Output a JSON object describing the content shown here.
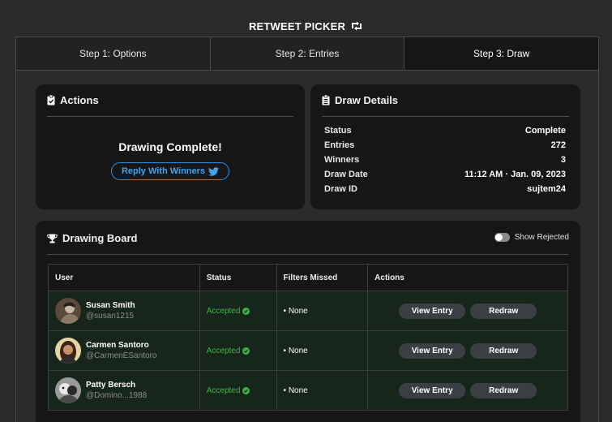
{
  "app": {
    "title": "RETWEET PICKER",
    "title_icon": "retweet-icon"
  },
  "tabs": [
    {
      "label": "Step 1: Options",
      "active": false
    },
    {
      "label": "Step 2: Entries",
      "active": false
    },
    {
      "label": "Step 3: Draw",
      "active": true
    }
  ],
  "actions_card": {
    "title": "Actions",
    "icon": "clipboard-check-icon",
    "status_message": "Drawing Complete!",
    "reply_button": "Reply With Winners",
    "reply_icon": "twitter-bird-icon"
  },
  "details_card": {
    "title": "Draw Details",
    "icon": "clipboard-list-icon",
    "rows": [
      {
        "label": "Status",
        "value": "Complete"
      },
      {
        "label": "Entries",
        "value": "272"
      },
      {
        "label": "Winners",
        "value": "3"
      },
      {
        "label": "Draw Date",
        "value": "11:12 AM · Jan. 09, 2023"
      },
      {
        "label": "Draw ID",
        "value": "sujtem24"
      }
    ]
  },
  "board": {
    "title": "Drawing Board",
    "icon": "trophy-icon",
    "toggle_label": "Show Rejected",
    "toggle_on": false,
    "columns": [
      "User",
      "Status",
      "Filters Missed",
      "Actions"
    ],
    "rows": [
      {
        "name": "Susan Smith",
        "handle": "@susan1215",
        "status": "Accepted",
        "filters": "• None",
        "view": "View Entry",
        "redraw": "Redraw"
      },
      {
        "name": "Carmen Santoro",
        "handle": "@CarmenESantoro",
        "status": "Accepted",
        "filters": "• None",
        "view": "View Entry",
        "redraw": "Redraw"
      },
      {
        "name": "Patty Bersch",
        "handle": "@Domino...1988",
        "status": "Accepted",
        "filters": "• None",
        "view": "View Entry",
        "redraw": "Redraw"
      }
    ]
  },
  "colors": {
    "accent": "#2b8fe0",
    "accepted": "#3bb54a",
    "row_bg": "#17261a",
    "card_bg": "#161616"
  }
}
